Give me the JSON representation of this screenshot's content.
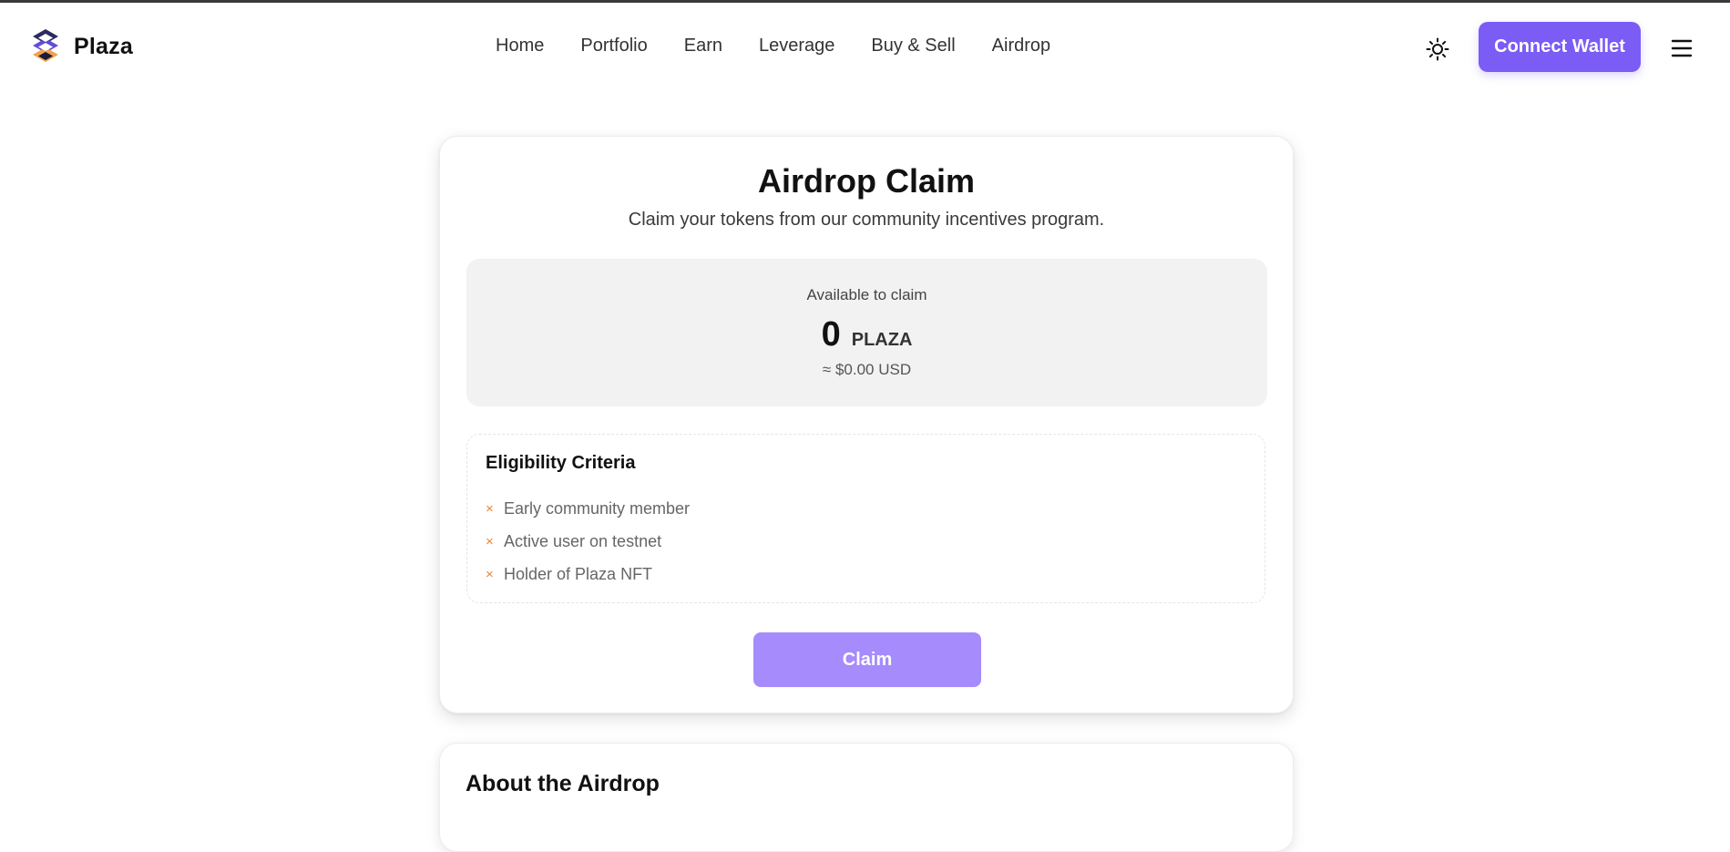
{
  "app": {
    "name": "Plaza",
    "accent_color": "#7b5cf5"
  },
  "header": {
    "logo_text": "Plaza",
    "logo_icon": "stacked-layers-icon",
    "nav": [
      {
        "label": "Home"
      },
      {
        "label": "Portfolio"
      },
      {
        "label": "Earn"
      },
      {
        "label": "Leverage"
      },
      {
        "label": "Buy & Sell"
      },
      {
        "label": "Airdrop"
      }
    ],
    "theme_toggle_icon": "sun-icon",
    "connect_wallet_label": "Connect Wallet",
    "menu_icon": "hamburger-menu-icon"
  },
  "airdrop_card": {
    "title": "Airdrop Claim",
    "subtitle": "Claim your tokens from our community incentives program.",
    "available_label": "Available to claim",
    "amount": "0",
    "token": "PLAZA",
    "usd_value": "≈ $0.00 USD",
    "criteria_title": "Eligibility Criteria",
    "criteria": [
      {
        "label": "Early community member",
        "met": false
      },
      {
        "label": "Active user on testnet",
        "met": false
      },
      {
        "label": "Holder of Plaza NFT",
        "met": false
      }
    ],
    "criteria_mark": "×",
    "criteria_mark_color": "#e8873a",
    "claim_button_label": "Claim",
    "claim_button_color": "#a58bfb"
  },
  "about_card": {
    "title": "About the Airdrop"
  }
}
